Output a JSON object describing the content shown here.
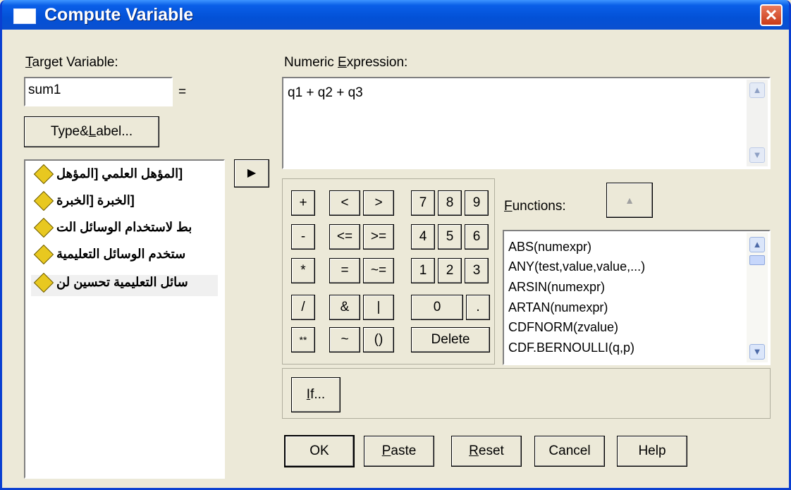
{
  "window": {
    "title": "Compute Variable",
    "close_glyph": "✕"
  },
  "target": {
    "label_pre": "",
    "label_u": "T",
    "label_post": "arget Variable:",
    "value": "sum1",
    "equals": "="
  },
  "type_label_button": {
    "pre": "Type&",
    "u": "L",
    "post": "abel..."
  },
  "move_button_glyph": "▶",
  "variables": [
    "[المؤهل العلمي [المؤهل",
    "[الخبرة [الخبرة",
    "بط لاستخدام الوسائل الت",
    "ستخدم الوسائل التعليمية",
    "سائل التعليمية تحسين لن"
  ],
  "numeric_expression": {
    "label_pre": "Numeric ",
    "label_u": "E",
    "label_post": "xpression:",
    "value": "q1 + q2 + q3"
  },
  "keypad": {
    "ops": [
      [
        "+",
        "<",
        ">"
      ],
      [
        "-",
        "<=",
        ">="
      ],
      [
        "*",
        "=",
        "~="
      ],
      [
        "/",
        "&",
        "|"
      ],
      [
        "**",
        "~",
        "()"
      ]
    ],
    "digits": [
      [
        "7",
        "8",
        "9"
      ],
      [
        "4",
        "5",
        "6"
      ],
      [
        "1",
        "2",
        "3"
      ]
    ],
    "zero": "0",
    "dot": ".",
    "delete": "Delete"
  },
  "functions": {
    "label_u": "F",
    "label_post": "unctions:",
    "up_glyph": "▲",
    "items": [
      "ABS(numexpr)",
      "ANY(test,value,value,...)",
      "ARSIN(numexpr)",
      "ARTAN(numexpr)",
      "CDFNORM(zvalue)",
      "CDF.BERNOULLI(q,p)"
    ]
  },
  "if_button": {
    "u": "I",
    "post": "f..."
  },
  "buttons": {
    "ok": "OK",
    "paste": {
      "u": "P",
      "post": "aste"
    },
    "reset": {
      "u": "R",
      "post": "eset"
    },
    "cancel": "Cancel",
    "help": "Help"
  }
}
